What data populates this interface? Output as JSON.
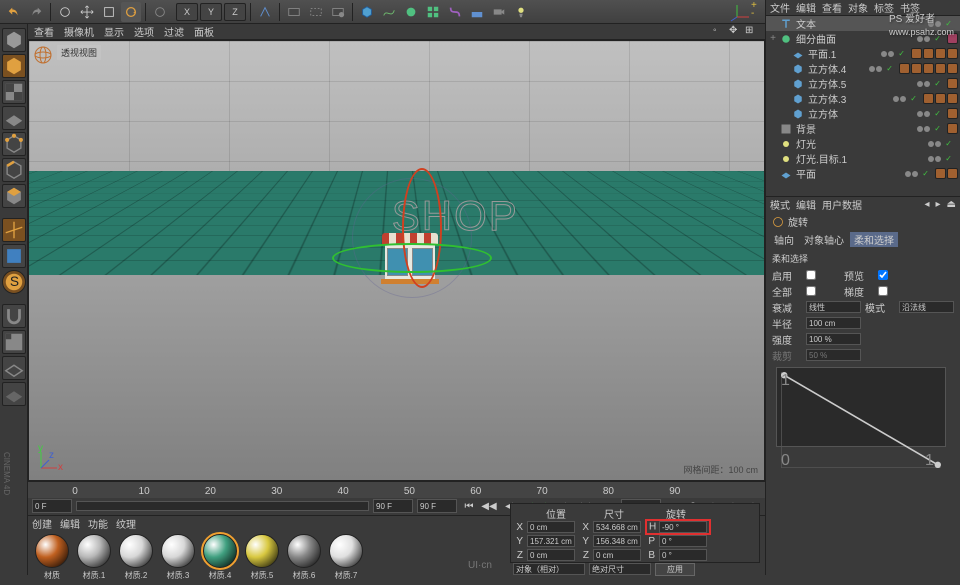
{
  "toolbar": {
    "axis_x": "X",
    "axis_y": "Y",
    "axis_z": "Z"
  },
  "view_menu": [
    "查看",
    "摄像机",
    "显示",
    "选项",
    "过滤",
    "面板"
  ],
  "viewport": {
    "label": "透视视图",
    "shop_text": "SHOP",
    "grid_info": "网格间距：100 cm"
  },
  "timeline": {
    "start": "0 F",
    "end": "90 F",
    "current": "0 F",
    "marks": [
      0,
      10,
      20,
      30,
      40,
      50,
      60,
      70,
      80,
      90
    ]
  },
  "materials": {
    "tabs": [
      "创建",
      "编辑",
      "功能",
      "纹理"
    ],
    "items": [
      {
        "name": "材质",
        "color": "#c06020"
      },
      {
        "name": "材质.1",
        "color": "#b8b8b8"
      },
      {
        "name": "材质.2",
        "color": "#d8d8d8"
      },
      {
        "name": "材质.3",
        "color": "#d8d8d8"
      },
      {
        "name": "材质.4",
        "color": "#40a080",
        "selected": true
      },
      {
        "name": "材质.5",
        "color": "#d8c840"
      },
      {
        "name": "材质.6",
        "color": "#888888"
      },
      {
        "name": "材质.7",
        "color": "#e0e0e0"
      }
    ]
  },
  "coords": {
    "header": [
      "位置",
      "尺寸",
      "旋转"
    ],
    "x_pos": "0 cm",
    "x_size": "534.668 cm",
    "h_rot": "-90 °",
    "y_pos": "157.321 cm",
    "y_size": "156.348 cm",
    "p_rot": "0 °",
    "z_pos": "0 cm",
    "z_size": "0 cm",
    "b_rot": "0 °",
    "mode": "对象（相对）",
    "size_mode": "绝对尺寸",
    "apply": "应用"
  },
  "obj_tabs": [
    "文件",
    "编辑",
    "查看",
    "对象",
    "标签",
    "书签"
  ],
  "objects": [
    {
      "name": "文本",
      "icon": "text",
      "depth": 0,
      "sel": true,
      "tags": []
    },
    {
      "name": "细分曲面",
      "icon": "sds",
      "depth": 0,
      "exp": "+",
      "tags": [
        "phong"
      ]
    },
    {
      "name": "平面.1",
      "icon": "plane",
      "depth": 1,
      "tags": [
        "mat",
        "mat",
        "mat",
        "mat"
      ]
    },
    {
      "name": "立方体.4",
      "icon": "cube",
      "depth": 1,
      "tags": [
        "mat",
        "mat",
        "mat",
        "mat",
        "mat"
      ]
    },
    {
      "name": "立方体.5",
      "icon": "cube",
      "depth": 1,
      "tags": [
        "mat"
      ]
    },
    {
      "name": "立方体.3",
      "icon": "cube",
      "depth": 1,
      "tags": [
        "mat",
        "mat",
        "mat"
      ]
    },
    {
      "name": "立方体",
      "icon": "cube",
      "depth": 1,
      "tags": [
        "mat"
      ]
    },
    {
      "name": "背景",
      "icon": "bg",
      "depth": 0,
      "tags": [
        "mat"
      ]
    },
    {
      "name": "灯光",
      "icon": "light",
      "depth": 0,
      "tags": []
    },
    {
      "name": "灯光.目标.1",
      "icon": "light",
      "depth": 0,
      "tags": []
    },
    {
      "name": "平面",
      "icon": "plane",
      "depth": 0,
      "tags": [
        "mat",
        "mat"
      ]
    }
  ],
  "attr": {
    "tabs": [
      "模式",
      "编辑",
      "用户数据"
    ],
    "title": "旋转",
    "subtabs": [
      "轴向",
      "对象轴心",
      "柔和选择"
    ],
    "soft_title": "柔和选择",
    "enable_lbl": "启用",
    "preview_lbl": "预览",
    "alldir_lbl": "全部",
    "surface_lbl": "梯度",
    "falloff_lbl": "衰减",
    "falloff_mode": "线性",
    "mode_lbl": "模式",
    "radius_lbl": "半径",
    "radius": "100 cm",
    "strength_lbl": "强度",
    "strength": "100 %",
    "clip_lbl": "裁剪",
    "clip": "50 %"
  },
  "watermark": {
    "main": "PS 爱好者",
    "sub": "www.psahz.com"
  },
  "footer_logo": "UI·cn",
  "side_text": "CINEMA 4D"
}
